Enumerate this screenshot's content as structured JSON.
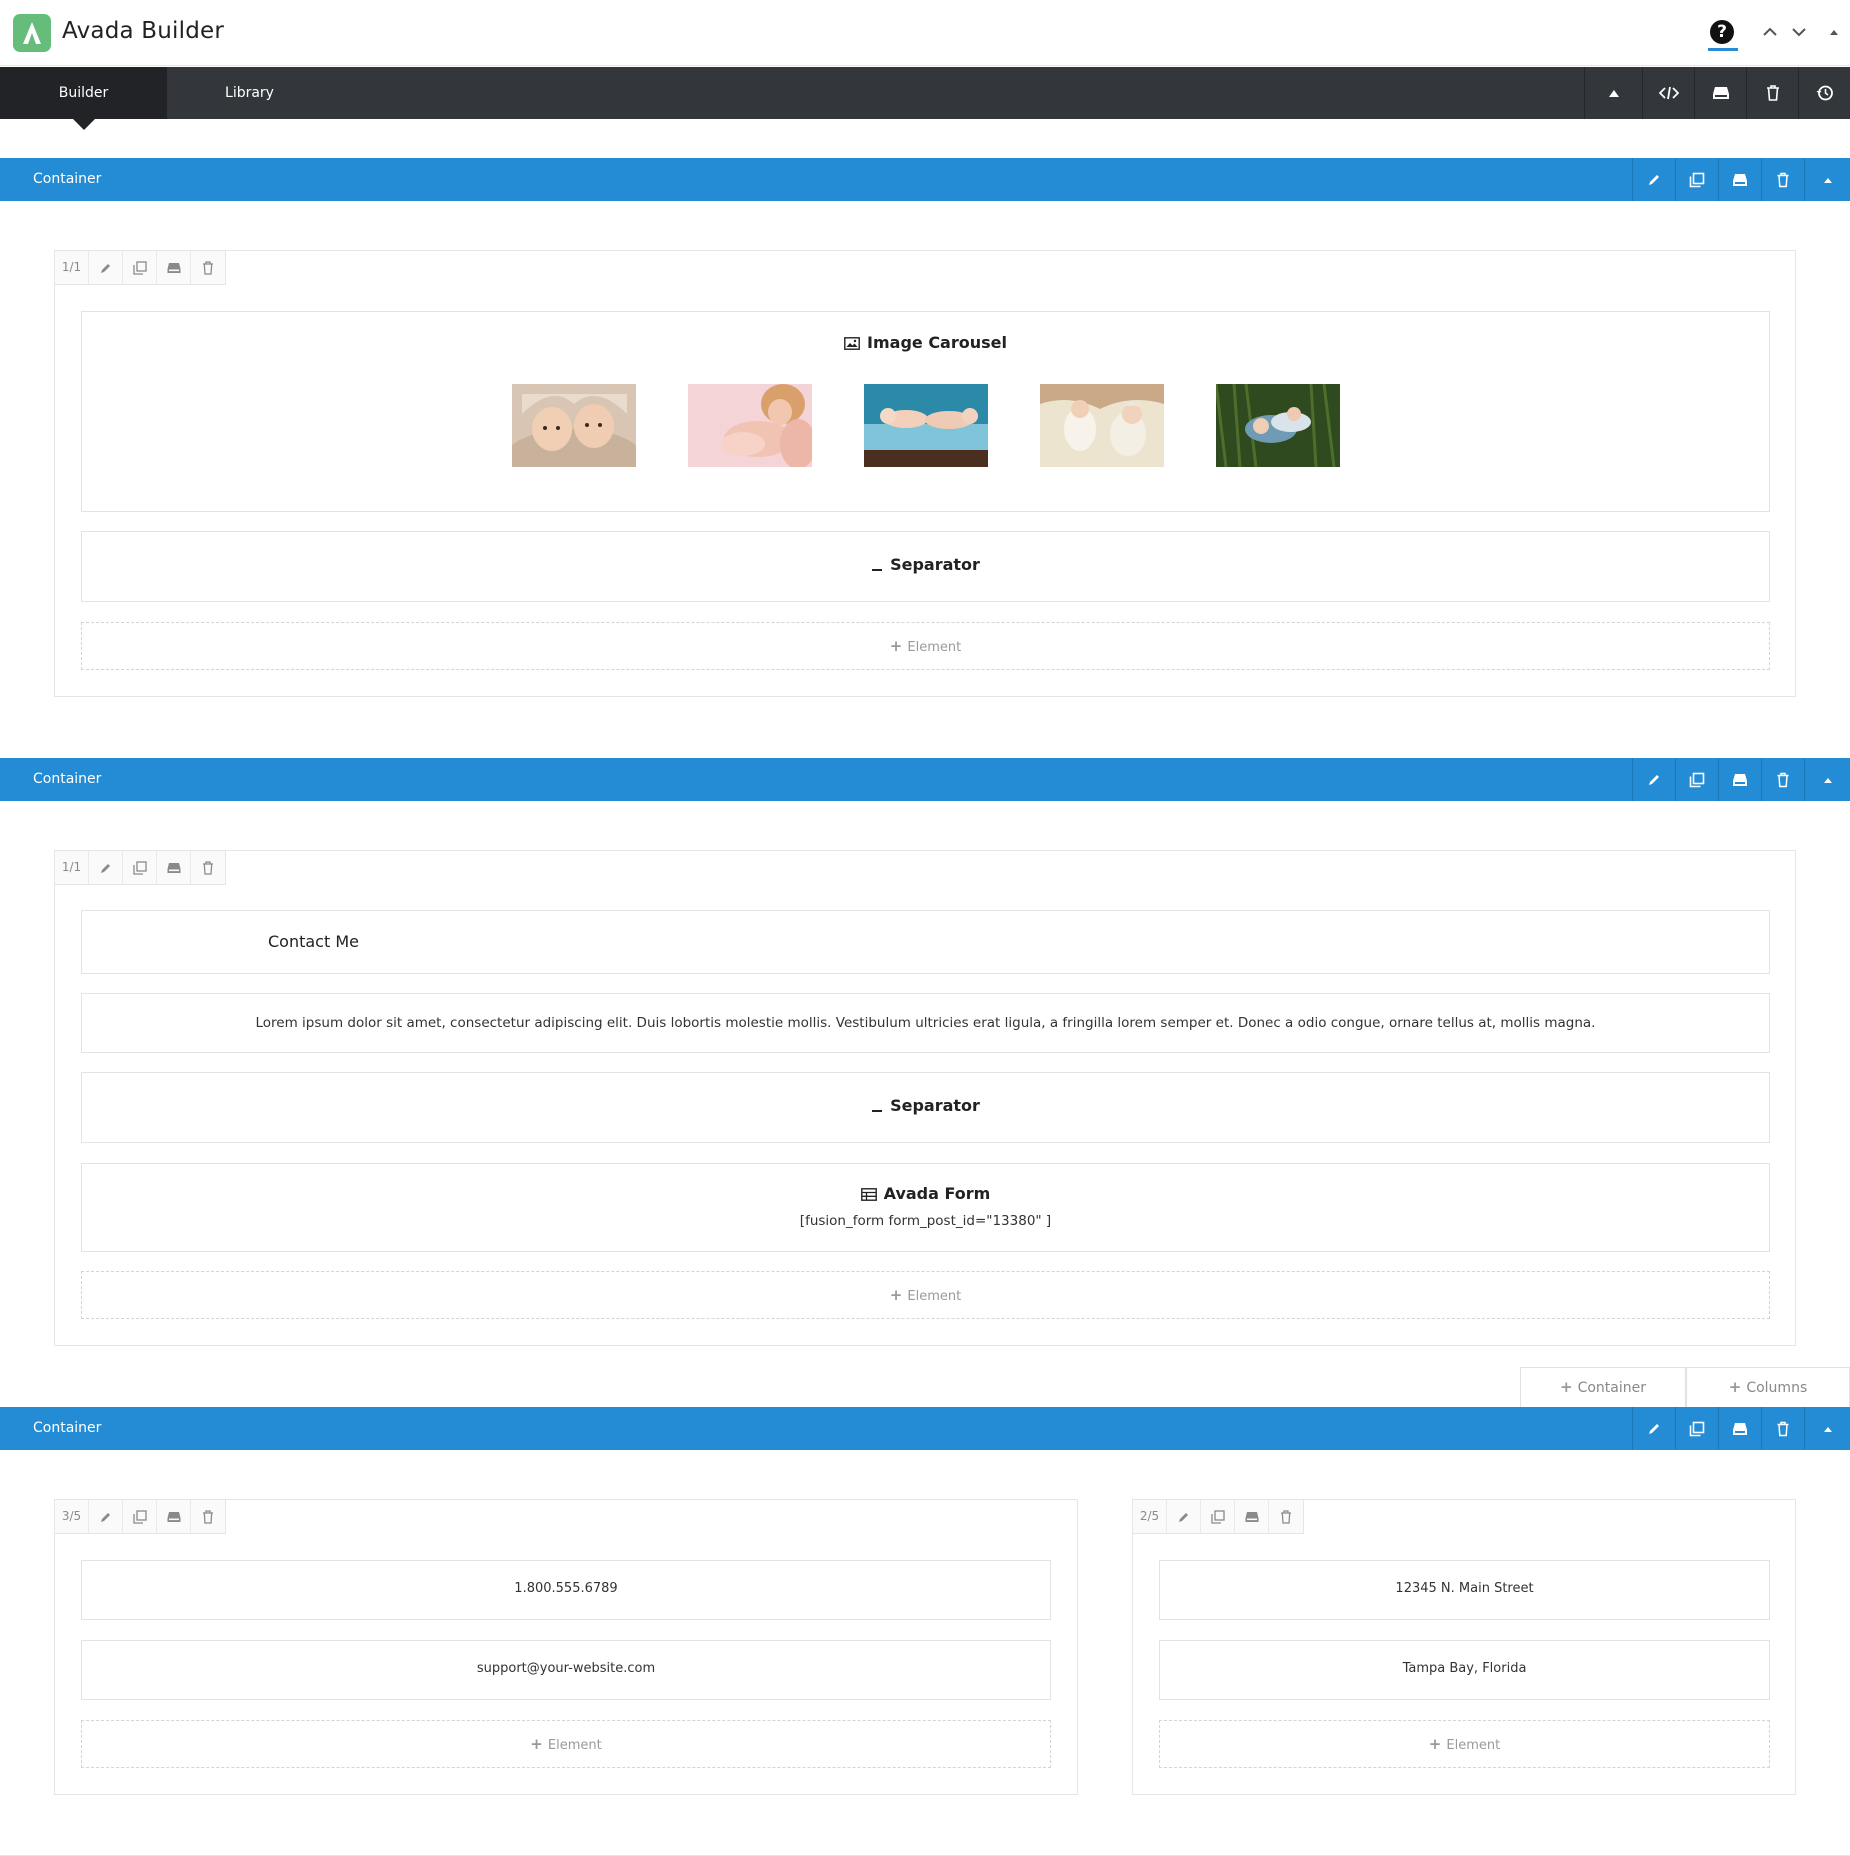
{
  "app": {
    "title": "Avada Builder"
  },
  "tabs": [
    {
      "label": "Builder"
    },
    {
      "label": "Library"
    }
  ],
  "colors": {
    "accent": "#238cd4",
    "tabbar": "#33373b",
    "logo": "#65bc7b"
  },
  "containers": [
    {
      "label": "Container",
      "columns": [
        {
          "size": "1/1",
          "elements": [
            {
              "type": "image-carousel",
              "title": "Image Carousel"
            },
            {
              "type": "separator",
              "title": "Separator"
            }
          ],
          "add_label": "Element"
        }
      ]
    },
    {
      "label": "Container",
      "columns": [
        {
          "size": "1/1",
          "elements": [
            {
              "type": "title",
              "text": "Contact Me"
            },
            {
              "type": "text",
              "text": "Lorem ipsum dolor sit amet, consectetur adipiscing elit. Duis lobortis molestie mollis. Vestibulum ultricies erat ligula, a fringilla lorem semper et. Donec a odio congue, ornare tellus at, mollis magna."
            },
            {
              "type": "separator",
              "title": "Separator"
            },
            {
              "type": "form",
              "title": "Avada Form",
              "shortcode": "[fusion_form form_post_id=\"13380\" ]"
            }
          ],
          "add_label": "Element"
        }
      ]
    },
    {
      "label": "Container",
      "columns": [
        {
          "size": "3/5",
          "elements": [
            {
              "type": "text",
              "text": "1.800.555.6789"
            },
            {
              "type": "text",
              "text": "support@your-website.com"
            }
          ],
          "add_label": "Element"
        },
        {
          "size": "2/5",
          "elements": [
            {
              "type": "text",
              "text": "12345 N. Main Street"
            },
            {
              "type": "text",
              "text": "Tampa Bay, Florida"
            }
          ],
          "add_label": "Element"
        }
      ]
    }
  ],
  "add_buttons": {
    "container": "Container",
    "columns": "Columns"
  }
}
